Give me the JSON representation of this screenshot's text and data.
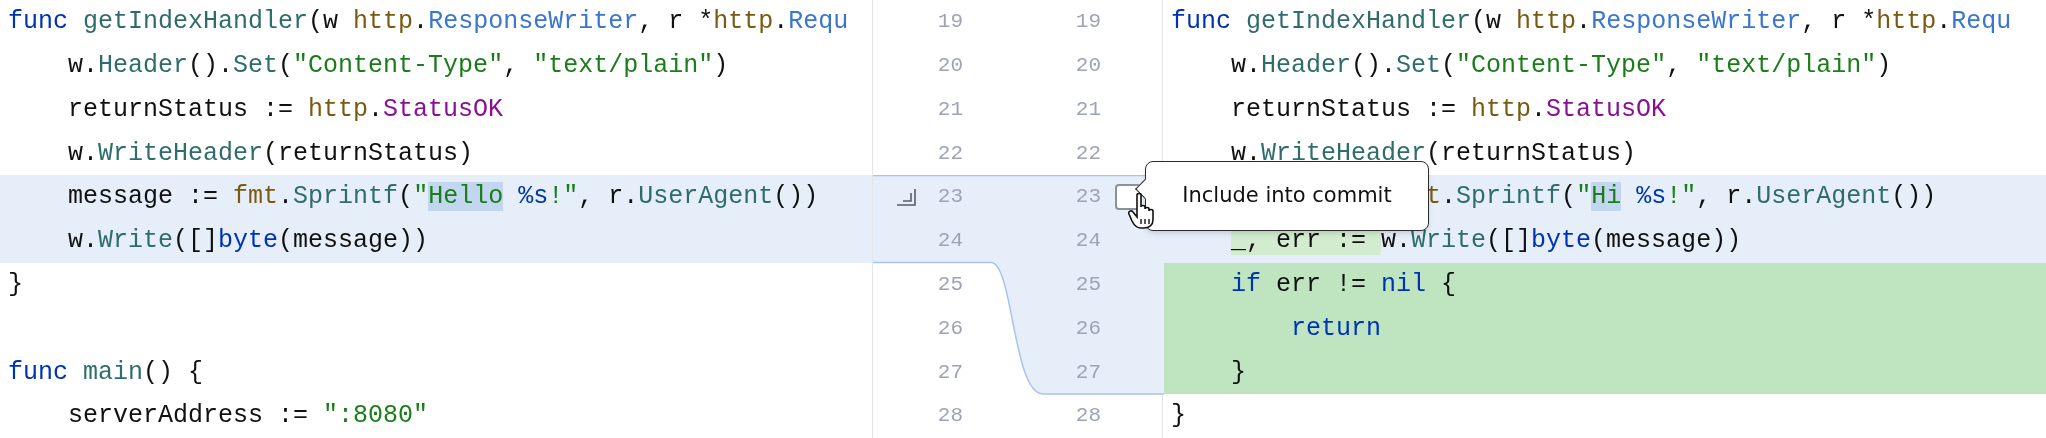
{
  "left_pane": {
    "lines": [
      {
        "kind": "context",
        "tokens": [
          {
            "kind": "keyword",
            "text": "func"
          },
          {
            "kind": "function",
            "text": " getIndexHandler"
          },
          {
            "kind": "plain",
            "text": "(w "
          },
          {
            "kind": "package",
            "text": "http"
          },
          {
            "kind": "plain",
            "text": "."
          },
          {
            "kind": "type",
            "text": "ResponseWriter"
          },
          {
            "kind": "plain",
            "text": ", r *"
          },
          {
            "kind": "package",
            "text": "http"
          },
          {
            "kind": "plain",
            "text": "."
          },
          {
            "kind": "type",
            "text": "Requ"
          }
        ]
      },
      {
        "kind": "context",
        "tokens": [
          {
            "kind": "plain",
            "text": "    w."
          },
          {
            "kind": "function",
            "text": "Header"
          },
          {
            "kind": "plain",
            "text": "()."
          },
          {
            "kind": "function",
            "text": "Set"
          },
          {
            "kind": "plain",
            "text": "("
          },
          {
            "kind": "string",
            "text": "\"Content-Type\""
          },
          {
            "kind": "plain",
            "text": ", "
          },
          {
            "kind": "string",
            "text": "\"text/plain\""
          },
          {
            "kind": "plain",
            "text": ")"
          }
        ]
      },
      {
        "kind": "context",
        "tokens": [
          {
            "kind": "plain",
            "text": "    returnStatus := "
          },
          {
            "kind": "package",
            "text": "http"
          },
          {
            "kind": "plain",
            "text": "."
          },
          {
            "kind": "constant",
            "text": "StatusOK"
          }
        ]
      },
      {
        "kind": "context",
        "tokens": [
          {
            "kind": "plain",
            "text": "    w."
          },
          {
            "kind": "function",
            "text": "WriteHeader"
          },
          {
            "kind": "plain",
            "text": "(returnStatus)"
          }
        ]
      },
      {
        "kind": "modified",
        "tokens": [
          {
            "kind": "plain",
            "text": "    message := "
          },
          {
            "kind": "package",
            "text": "fmt"
          },
          {
            "kind": "plain",
            "text": "."
          },
          {
            "kind": "function",
            "text": "Sprintf"
          },
          {
            "kind": "plain",
            "text": "("
          },
          {
            "kind": "string",
            "text": "\""
          },
          {
            "kind": "string",
            "text": "Hello",
            "changed": true
          },
          {
            "kind": "format",
            "text": " %s"
          },
          {
            "kind": "string",
            "text": "!\""
          },
          {
            "kind": "plain",
            "text": ", r."
          },
          {
            "kind": "function",
            "text": "UserAgent"
          },
          {
            "kind": "plain",
            "text": "())"
          }
        ]
      },
      {
        "kind": "modified",
        "tokens": [
          {
            "kind": "plain",
            "text": "    w."
          },
          {
            "kind": "function",
            "text": "Write"
          },
          {
            "kind": "plain",
            "text": "([]"
          },
          {
            "kind": "keyword",
            "text": "byte"
          },
          {
            "kind": "plain",
            "text": "(message))"
          }
        ]
      },
      {
        "kind": "context",
        "tokens": [
          {
            "kind": "plain",
            "text": "}"
          }
        ]
      },
      {
        "kind": "context"
      },
      {
        "kind": "context",
        "tokens": [
          {
            "kind": "keyword",
            "text": "func"
          },
          {
            "kind": "function",
            "text": " main"
          },
          {
            "kind": "plain",
            "text": "() {"
          }
        ]
      },
      {
        "kind": "context",
        "tokens": [
          {
            "kind": "plain",
            "text": "    serverAddress := "
          },
          {
            "kind": "string",
            "text": "\":8080\""
          }
        ]
      }
    ]
  },
  "gutter": {
    "rows": [
      {
        "kind": "plain",
        "left_number": "19",
        "right_number": "19"
      },
      {
        "kind": "plain",
        "left_number": "20",
        "right_number": "20"
      },
      {
        "kind": "plain",
        "left_number": "21",
        "right_number": "21"
      },
      {
        "kind": "plain",
        "left_number": "22",
        "right_number": "22"
      },
      {
        "kind": "hunk_start",
        "left_number": "23",
        "right_number": "23",
        "checked": false
      },
      {
        "kind": "plain",
        "left_number": "24",
        "right_number": "24"
      },
      {
        "kind": "plain",
        "left_number": "25",
        "right_number": "25"
      },
      {
        "kind": "plain",
        "left_number": "26",
        "right_number": "26"
      },
      {
        "kind": "plain",
        "left_number": "27",
        "right_number": "27"
      },
      {
        "kind": "plain",
        "left_number": "28",
        "right_number": "28"
      }
    ]
  },
  "right_pane": {
    "lines": [
      {
        "kind": "context",
        "tokens": [
          {
            "kind": "keyword",
            "text": "func"
          },
          {
            "kind": "function",
            "text": " getIndexHandler"
          },
          {
            "kind": "plain",
            "text": "(w "
          },
          {
            "kind": "package",
            "text": "http"
          },
          {
            "kind": "plain",
            "text": "."
          },
          {
            "kind": "type",
            "text": "ResponseWriter"
          },
          {
            "kind": "plain",
            "text": ", r *"
          },
          {
            "kind": "package",
            "text": "http"
          },
          {
            "kind": "plain",
            "text": "."
          },
          {
            "kind": "type",
            "text": "Requ"
          }
        ]
      },
      {
        "kind": "context",
        "tokens": [
          {
            "kind": "plain",
            "text": "    w."
          },
          {
            "kind": "function",
            "text": "Header"
          },
          {
            "kind": "plain",
            "text": "()."
          },
          {
            "kind": "function",
            "text": "Set"
          },
          {
            "kind": "plain",
            "text": "("
          },
          {
            "kind": "string",
            "text": "\"Content-Type\""
          },
          {
            "kind": "plain",
            "text": ", "
          },
          {
            "kind": "string",
            "text": "\"text/plain\""
          },
          {
            "kind": "plain",
            "text": ")"
          }
        ]
      },
      {
        "kind": "context",
        "tokens": [
          {
            "kind": "plain",
            "text": "    returnStatus := "
          },
          {
            "kind": "package",
            "text": "http"
          },
          {
            "kind": "plain",
            "text": "."
          },
          {
            "kind": "constant",
            "text": "StatusOK"
          }
        ]
      },
      {
        "kind": "context",
        "tokens": [
          {
            "kind": "plain",
            "text": "    w."
          },
          {
            "kind": "function",
            "text": "WriteHeader"
          },
          {
            "kind": "plain",
            "text": "(returnStatus)"
          }
        ]
      },
      {
        "kind": "modified",
        "tokens": [
          {
            "kind": "package",
            "text": "                 t"
          },
          {
            "kind": "plain",
            "text": "."
          },
          {
            "kind": "function",
            "text": "Sprintf"
          },
          {
            "kind": "plain",
            "text": "("
          },
          {
            "kind": "string",
            "text": "\""
          },
          {
            "kind": "string",
            "text": "Hi",
            "changed": true
          },
          {
            "kind": "format",
            "text": " %s"
          },
          {
            "kind": "string",
            "text": "!\""
          },
          {
            "kind": "plain",
            "text": ", r."
          },
          {
            "kind": "function",
            "text": "UserAgent"
          },
          {
            "kind": "plain",
            "text": "())"
          }
        ]
      },
      {
        "kind": "modified",
        "tokens": [
          {
            "kind": "plain",
            "text": "    _, err := ",
            "inserted": true
          },
          {
            "kind": "plain",
            "text": "w."
          },
          {
            "kind": "function",
            "text": "Write"
          },
          {
            "kind": "plain",
            "text": "([]"
          },
          {
            "kind": "keyword",
            "text": "byte"
          },
          {
            "kind": "plain",
            "text": "(message))"
          }
        ]
      },
      {
        "kind": "added",
        "tokens": [
          {
            "kind": "keyword",
            "text": "    if"
          },
          {
            "kind": "plain",
            "text": " err != "
          },
          {
            "kind": "keyword",
            "text": "nil"
          },
          {
            "kind": "plain",
            "text": " {"
          }
        ]
      },
      {
        "kind": "added",
        "tokens": [
          {
            "kind": "keyword",
            "text": "        return"
          }
        ]
      },
      {
        "kind": "added",
        "tokens": [
          {
            "kind": "plain",
            "text": "    }"
          }
        ]
      },
      {
        "kind": "context",
        "tokens": [
          {
            "kind": "plain",
            "text": "}"
          }
        ]
      }
    ]
  },
  "tooltip": {
    "text": "Include into commit"
  }
}
